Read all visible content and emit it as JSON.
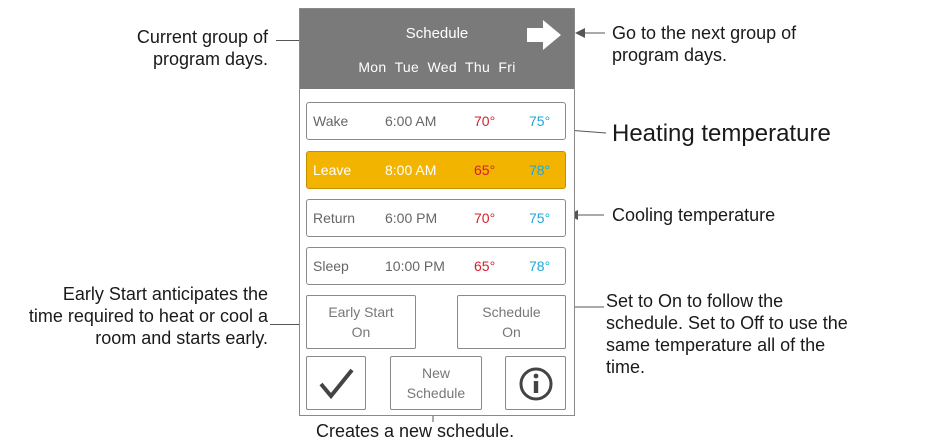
{
  "screen": {
    "title": "Schedule",
    "days": "Mon  Tue  Wed  Thu  Fri",
    "periods": [
      {
        "name": "Wake",
        "time": "6:00 AM",
        "heat": "70°",
        "cool": "75°",
        "selected": false
      },
      {
        "name": "Leave",
        "time": "8:00 AM",
        "heat": "65°",
        "cool": "78°",
        "selected": true
      },
      {
        "name": "Return",
        "time": "6:00 PM",
        "heat": "70°",
        "cool": "75°",
        "selected": false
      },
      {
        "name": "Sleep",
        "time": "10:00 PM",
        "heat": "65°",
        "cool": "78°",
        "selected": false
      }
    ],
    "early_start": {
      "line1": "Early Start",
      "line2": "On"
    },
    "schedule_toggle": {
      "line1": "Schedule",
      "line2": "On"
    },
    "new_schedule": {
      "line1": "New",
      "line2": "Schedule"
    },
    "icons": {
      "next": "arrow-right-icon",
      "done": "checkmark-icon",
      "info": "info-icon"
    }
  },
  "annotations": {
    "current_group": [
      "Current group of",
      "program days."
    ],
    "next_group": [
      "Go to the next group of",
      "program days."
    ],
    "heating": "Heating temperature",
    "cooling": "Cooling temperature",
    "early_start": [
      "Early Start anticipates the",
      "time required to heat or cool a",
      "room and starts early."
    ],
    "schedule": [
      "Set to On to follow the",
      "schedule. Set to Off to use the",
      "same temperature all of the",
      "time."
    ],
    "new_schedule": "Creates a new schedule."
  },
  "colors": {
    "header": "#7a7a7a",
    "selected": "#f3b400",
    "heat": "#d4212b",
    "cool": "#1ea7d6"
  }
}
